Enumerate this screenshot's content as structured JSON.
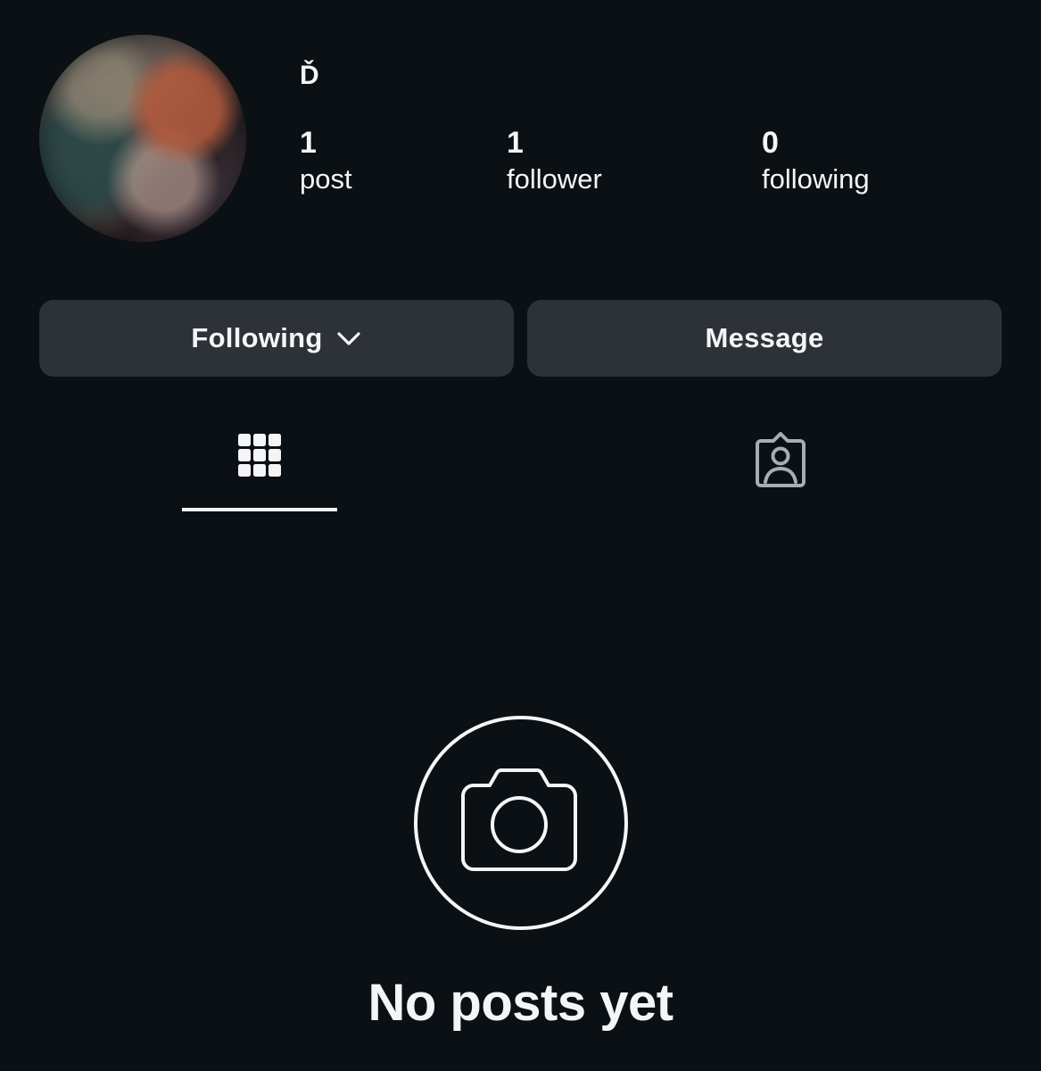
{
  "profile": {
    "username": "Ď",
    "avatar_alt": "profile photo"
  },
  "stats": {
    "posts_count": "1",
    "posts_label": "post",
    "followers_count": "1",
    "followers_label": "follower",
    "following_count": "0",
    "following_label": "following"
  },
  "actions": {
    "following_label": "Following",
    "message_label": "Message"
  },
  "tabs": {
    "grid_icon": "grid-icon",
    "tagged_icon": "tagged-person-icon",
    "active": "grid"
  },
  "empty_state": {
    "icon": "camera-icon",
    "title": "No posts yet"
  },
  "colors": {
    "background": "#0b1014",
    "button": "#2d3138",
    "text": "#f5f5f5",
    "inactive_icon": "#a8acb3"
  }
}
